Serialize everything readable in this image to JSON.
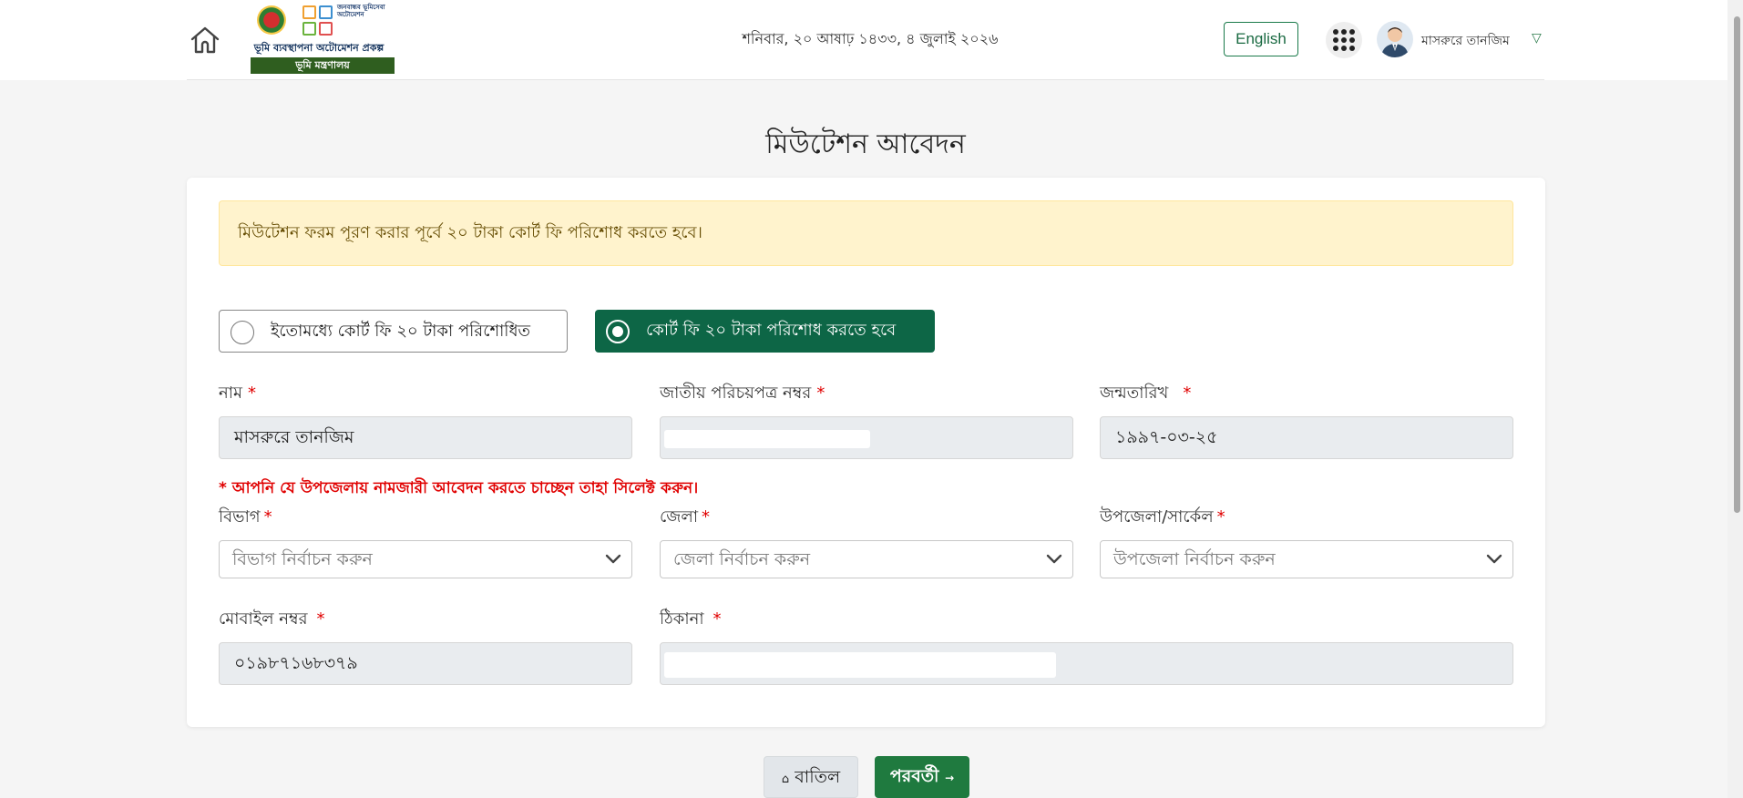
{
  "header": {
    "logo_title": "ভূমি ব্যবস্থাপনা অটোমেশন প্রকল্প",
    "logo_side_text": "জনবান্ধব ভূমিসেবা অটোমেশন",
    "logo_ministry": "ভূমি মন্ত্রণালয়",
    "date": "শনিবার, ২০ আষাঢ় ১৪৩৩, ৪ জুলাই ২০২৬",
    "lang_button": "English",
    "user_name": "মাসরুরে তানজিম",
    "user_caret": "▽"
  },
  "page": {
    "title": "মিউটেশন আবেদন"
  },
  "alert": {
    "text": "মিউটেশন ফরম পূরণ করার পূর্বে ২০ টাকা কোর্ট ফি পরিশোধ করতে হবে।"
  },
  "payment_options": [
    {
      "label": "ইতোমধ্যে কোর্ট ফি ২০ টাকা পরিশোধিত",
      "selected": false
    },
    {
      "label": "কোর্ট ফি ২০ টাকা পরিশোধ করতে হবে",
      "selected": true
    }
  ],
  "form": {
    "required_mark": "*",
    "name": {
      "label": "নাম",
      "value": "মাসরুরে তানজিম"
    },
    "nid": {
      "label": "জাতীয় পরিচয়পত্র নম্বর",
      "value": ""
    },
    "dob": {
      "label": "জন্মতারিখ",
      "value": "১৯৯৭-০৩-২৫"
    },
    "notice": "* আপনি যে উপজেলায় নামজারী আবেদন করতে চাচ্ছেন তাহা সিলেক্ট করুন।",
    "division": {
      "label": "বিভাগ",
      "placeholder": "বিভাগ নির্বাচন করুন"
    },
    "district": {
      "label": "জেলা",
      "placeholder": "জেলা নির্বাচন করুন"
    },
    "upazila": {
      "label": "উপজেলা/সার্কেল",
      "placeholder": "উপজেলা নির্বাচন করুন"
    },
    "mobile": {
      "label": "মোবাইল নম্বর",
      "value": "০১৯৮৭১৬৮৩৭৯"
    },
    "address": {
      "label": "ঠিকানা",
      "value": ""
    }
  },
  "actions": {
    "cancel_icon": "home-icon",
    "cancel_label": "বাতিল",
    "next_label": "পরবর্তী",
    "next_icon": "→"
  },
  "colors": {
    "primary_green": "#0d6646",
    "next_green": "#1f7a3f",
    "required_red": "#e00000",
    "alert_bg": "#fff3cd"
  }
}
